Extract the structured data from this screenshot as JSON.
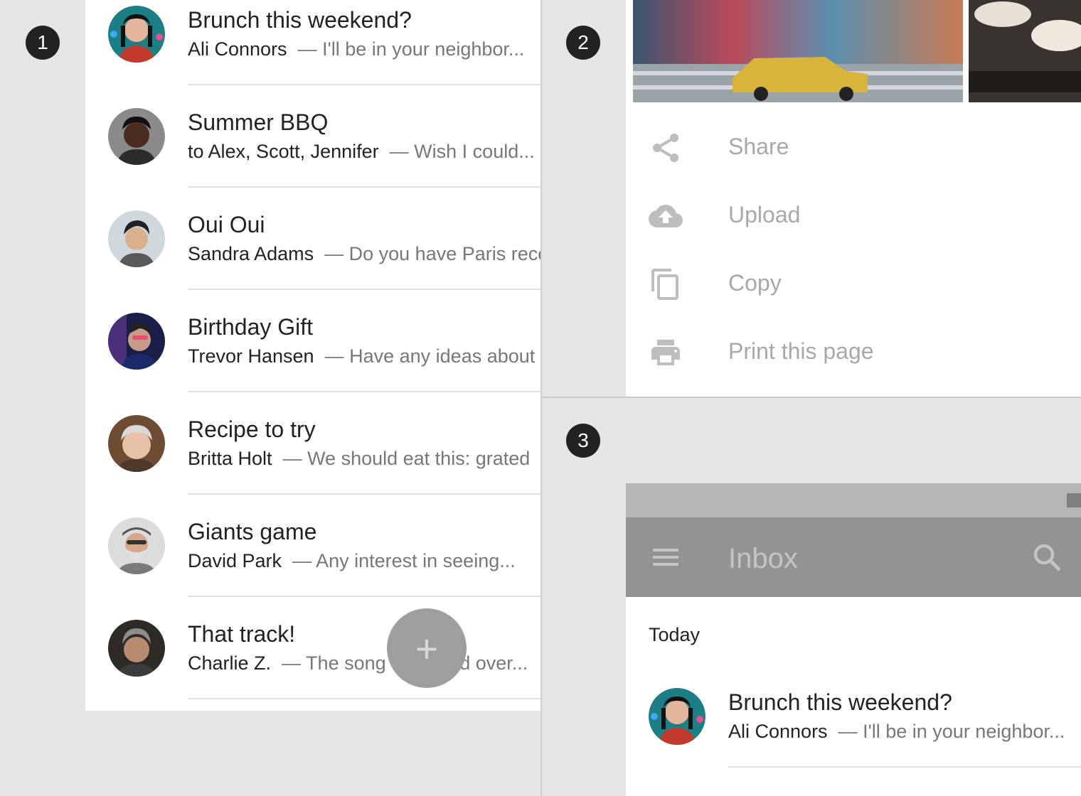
{
  "badges": [
    "1",
    "2",
    "3"
  ],
  "email_list": [
    {
      "subject": "Brunch this weekend?",
      "sender": "Ali Connors",
      "snippet": "— I'll be in your neighbor..."
    },
    {
      "subject": "Summer BBQ",
      "sender": "to Alex, Scott, Jennifer",
      "snippet": "— Wish I could..."
    },
    {
      "subject": "Oui Oui",
      "sender": "Sandra Adams",
      "snippet": "— Do you have Paris recommendations"
    },
    {
      "subject": "Birthday Gift",
      "sender": "Trevor Hansen",
      "snippet": "— Have any ideas about"
    },
    {
      "subject": "Recipe to try",
      "sender": "Britta Holt",
      "snippet": "— We should eat this: grated"
    },
    {
      "subject": "Giants game",
      "sender": "David Park",
      "snippet": "— Any interest in seeing..."
    },
    {
      "subject": "That track!",
      "sender": "Charlie Z.",
      "snippet": "— The song we heard over..."
    }
  ],
  "fab": {
    "icon": "plus-icon",
    "label": "+"
  },
  "bottom_sheet": {
    "items": [
      {
        "label": "Share",
        "icon": "share-icon"
      },
      {
        "label": "Upload",
        "icon": "cloud-upload-icon"
      },
      {
        "label": "Copy",
        "icon": "copy-icon"
      },
      {
        "label": "Print this page",
        "icon": "print-icon"
      }
    ]
  },
  "inbox": {
    "title": "Inbox",
    "section": "Today",
    "email": {
      "subject": "Brunch this weekend?",
      "sender": "Ali Connors",
      "snippet": "— I'll be in your neighbor..."
    }
  },
  "colors": {
    "fab": "#9e9e9e",
    "appbar": "#939393",
    "statusbar": "#b6b6b6",
    "badge": "#222222"
  }
}
